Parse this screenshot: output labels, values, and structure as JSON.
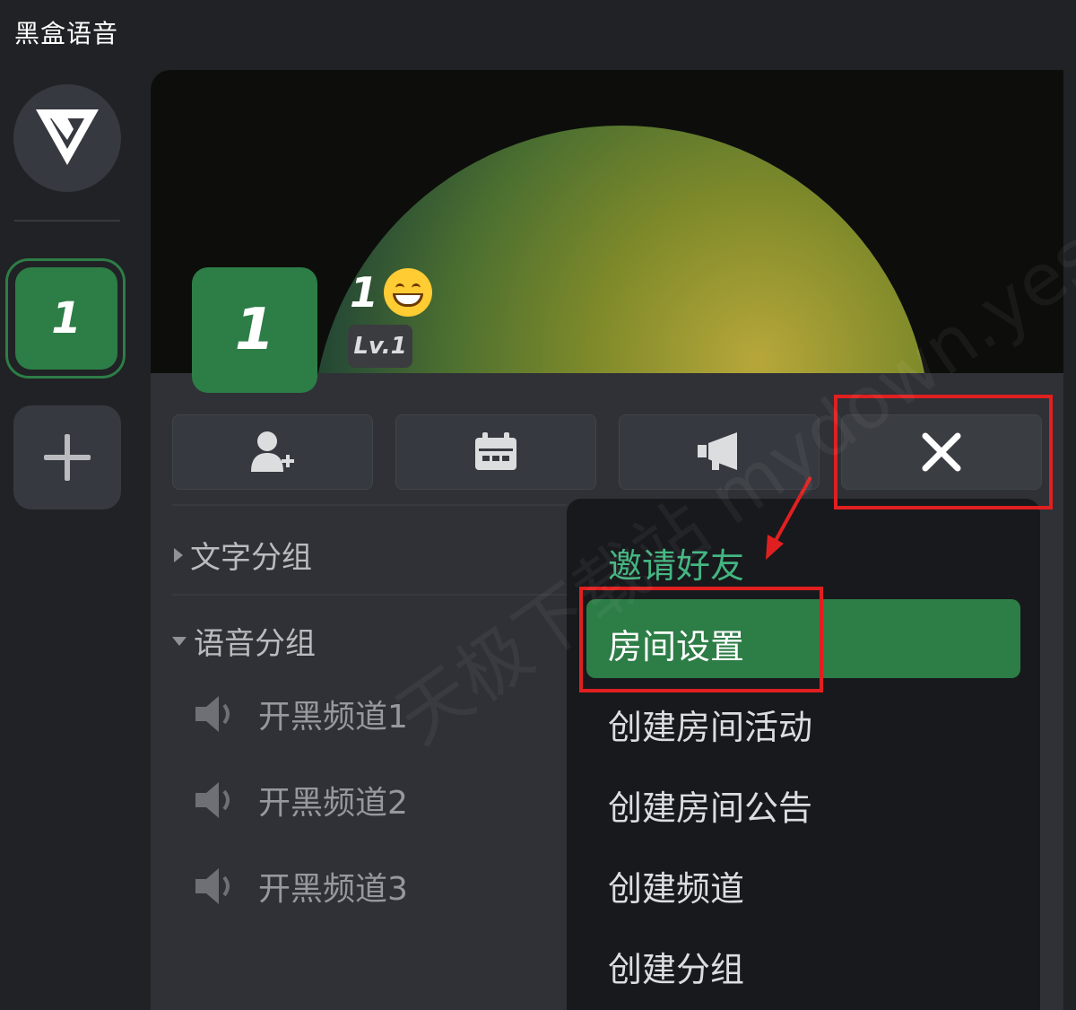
{
  "app": {
    "title": "黑盒语音"
  },
  "rail": {
    "server_label": "1"
  },
  "room": {
    "avatar_label": "1",
    "name": "1",
    "level": "Lv.1"
  },
  "toolbar": {
    "icons": [
      "add-user-icon",
      "calendar-icon",
      "megaphone-icon",
      "close-icon"
    ]
  },
  "groups": [
    {
      "label": "文字分组",
      "expanded": false
    },
    {
      "label": "语音分组",
      "expanded": true
    }
  ],
  "channels": [
    "开黑频道1",
    "开黑频道2",
    "开黑频道3"
  ],
  "menu": {
    "invite": "邀请好友",
    "items": [
      "房间设置",
      "创建房间活动",
      "创建房间公告",
      "创建频道",
      "创建分组"
    ],
    "selected_index": 0
  },
  "watermark": "天极下载站 mydown.yesky.com",
  "colors": {
    "accent": "#2d7d46",
    "invite": "#43b581",
    "annotation": "#e02020"
  }
}
